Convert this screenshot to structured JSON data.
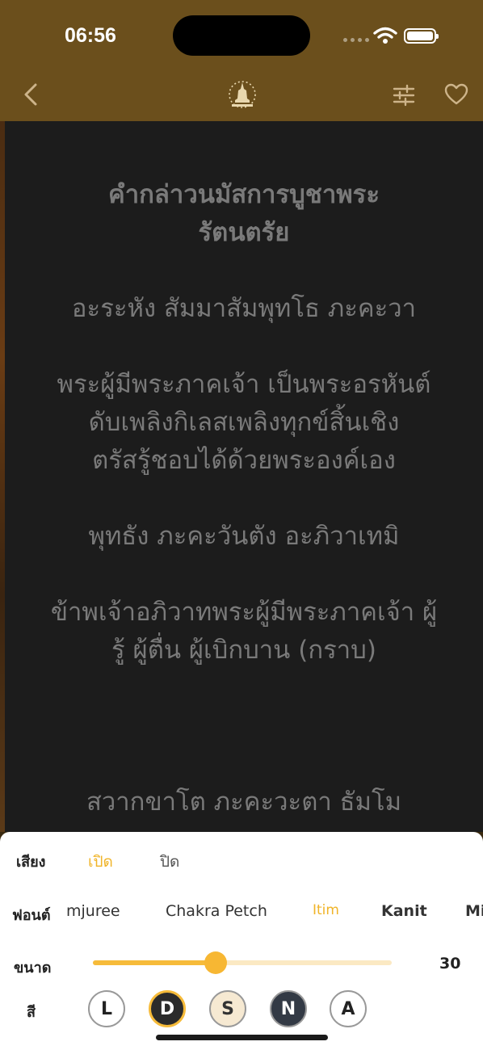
{
  "status": {
    "time": "06:56"
  },
  "chant": {
    "title_line1": "คำกล่าวนมัสการบูชาพระ",
    "title_line2": "รัตนตรัย",
    "verses": [
      {
        "lines": [
          "อะระหัง สัมมาสัมพุทโธ ภะคะวา"
        ]
      },
      {
        "lines": [
          "พระผู้มีพระภาคเจ้า เป็นพระอรหันต์",
          "ดับเพลิงกิเลสเพลิงทุกข์สิ้นเชิง",
          "ตรัสรู้ชอบได้ด้วยพระองค์เอง"
        ]
      },
      {
        "lines": [
          "พุทธัง ภะคะวันตัง อะภิวาเทมิ"
        ]
      },
      {
        "lines": [
          "ข้าพเจ้าอภิวาทพระผู้มีพระภาคเจ้า ผู้",
          "รู้ ผู้ตื่น ผู้เบิกบาน (กราบ)"
        ]
      }
    ],
    "partial_line": "สวากขาโต ภะคะวะตา ธัมโม"
  },
  "settings": {
    "sound": {
      "label": "เสียง",
      "on": "เปิด",
      "off": "ปิด",
      "selected": "on"
    },
    "font": {
      "label": "ฟอนต์",
      "options": [
        "mjuree",
        "Chakra Petch",
        "Itim",
        "Kanit",
        "Mi"
      ],
      "selected": "Itim"
    },
    "size": {
      "label": "ขนาด",
      "value": "30",
      "fraction": 0.41
    },
    "color": {
      "label": "สี",
      "options": [
        {
          "key": "L",
          "bg": "#ffffff",
          "fg": "#222222",
          "border": "#999999"
        },
        {
          "key": "D",
          "bg": "#2b2b2b",
          "fg": "#ffffff",
          "border": "#f6bb3a"
        },
        {
          "key": "S",
          "bg": "#f6e9d2",
          "fg": "#333333",
          "border": "#999999"
        },
        {
          "key": "N",
          "bg": "#333a45",
          "fg": "#ffffff",
          "border": "#999999"
        },
        {
          "key": "A",
          "bg": "#ffffff",
          "fg": "#222222",
          "border": "#999999"
        }
      ],
      "selected": "D"
    }
  },
  "theme": {
    "header_bg": "#6b4f1c",
    "accent": "#f0b429",
    "content_bg": "#1c1c1c",
    "text_gray": "#7a7a7a"
  }
}
